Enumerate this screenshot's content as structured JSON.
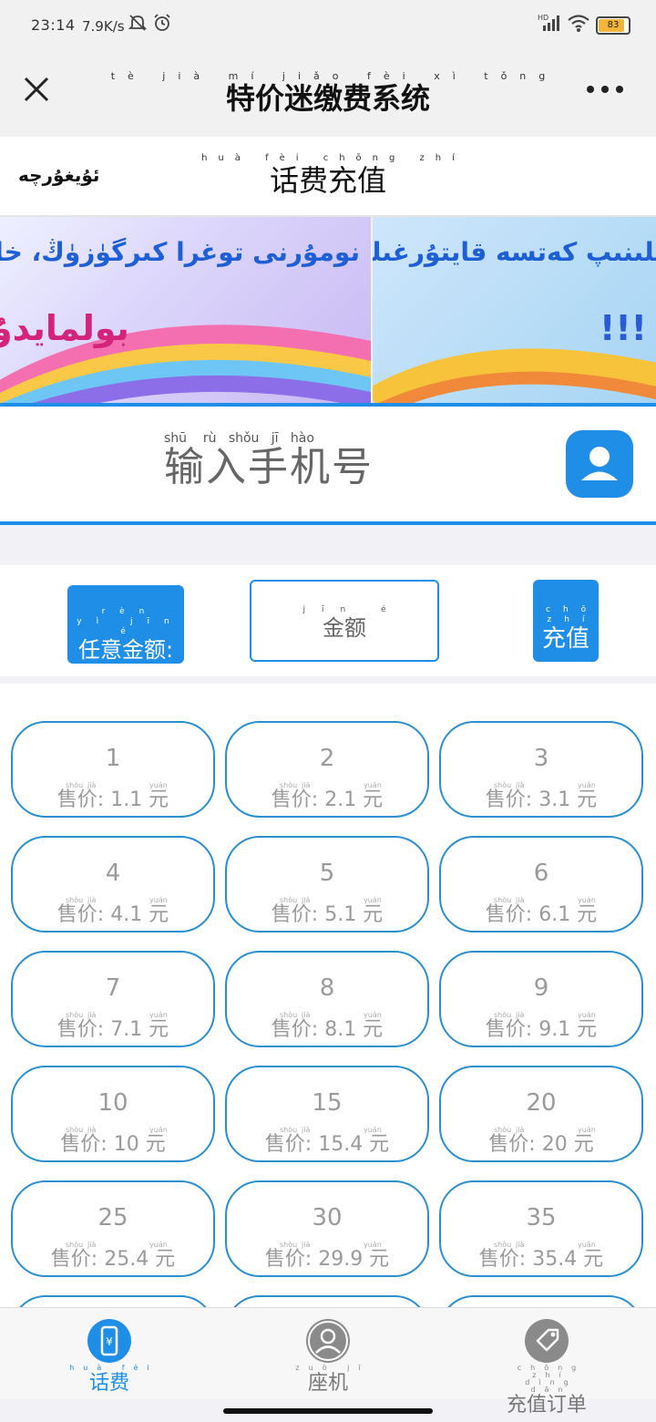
{
  "status_bar": {
    "time": "23:14",
    "speed": "7.9K/s",
    "battery": "83"
  },
  "nav": {
    "title": "特价迷缴费系统",
    "title_pinyin": [
      "tè",
      "jià",
      "mí",
      "jiǎo",
      "fèi",
      "xì",
      "tǒng"
    ]
  },
  "subheader": {
    "lang_label": "ئۇيغۇرچە",
    "title": "话费充值",
    "title_pinyin": [
      "huà",
      "fèi",
      "chōng",
      "zhí"
    ]
  },
  "banner": {
    "slide1_line1": "نومۇرنى توغرا كىرگۈزۈڭ، خاتا قاچىلىنىپ",
    "slide1_line2": "بولمايدۇ",
    "slide2_line1": "چىلىنىپ كەتسە قايتۇرغىلى",
    "slide2_line2": "!!!"
  },
  "phone": {
    "placeholder": "输入手机号",
    "placeholder_pinyin": "shū    rù   shǒu   jī   hào"
  },
  "custom": {
    "any_amount_label": "任意金额:",
    "any_amount_pinyin": [
      "rèn",
      "yì",
      "jīn",
      "é"
    ],
    "amount_placeholder": "金额",
    "amount_pinyin": [
      "jīn",
      "é"
    ],
    "charge_label": "充值",
    "charge_pinyin": [
      "chōng",
      "zhí"
    ]
  },
  "price_pinyin": {
    "shou": "shòu",
    "jia": "jià",
    "yuan": "yuán"
  },
  "plans": [
    {
      "amount": "1",
      "price": "售价: 1.1 元"
    },
    {
      "amount": "2",
      "price": "售价: 2.1 元"
    },
    {
      "amount": "3",
      "price": "售价: 3.1 元"
    },
    {
      "amount": "4",
      "price": "售价: 4.1 元"
    },
    {
      "amount": "5",
      "price": "售价: 5.1 元"
    },
    {
      "amount": "6",
      "price": "售价: 6.1 元"
    },
    {
      "amount": "7",
      "price": "售价: 7.1 元"
    },
    {
      "amount": "8",
      "price": "售价: 8.1 元"
    },
    {
      "amount": "9",
      "price": "售价: 9.1 元"
    },
    {
      "amount": "10",
      "price": "售价: 10 元"
    },
    {
      "amount": "15",
      "price": "售价: 15.4 元"
    },
    {
      "amount": "20",
      "price": "售价: 20 元"
    },
    {
      "amount": "25",
      "price": "售价: 25.4 元"
    },
    {
      "amount": "30",
      "price": "售价: 29.9 元"
    },
    {
      "amount": "35",
      "price": "售价: 35.4 元"
    }
  ],
  "tabs": [
    {
      "label": "话费",
      "pinyin": [
        "huà",
        "fèi"
      ],
      "icon": "phone-yuan-icon",
      "active": true
    },
    {
      "label": "座机",
      "pinyin": [
        "zuò",
        "jī"
      ],
      "icon": "person-icon",
      "active": false
    },
    {
      "label": "充值订单",
      "pinyin": [
        "chōng",
        "zhí",
        "dìng",
        "dān"
      ],
      "icon": "tag-icon",
      "active": false
    }
  ],
  "colors": {
    "accent": "#1f8ee6",
    "plan_border": "#2a8fce",
    "muted_text": "#9a9a9a"
  }
}
